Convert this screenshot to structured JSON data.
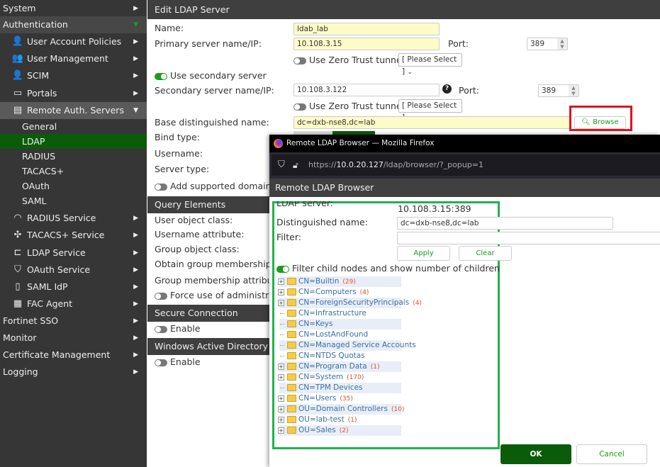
{
  "sidebar": {
    "items": [
      {
        "label": "System",
        "arrow": "▶"
      },
      {
        "label": "Authentication",
        "arrow": "▼"
      },
      {
        "label": "User Account Policies",
        "icon": "user-gear-icon"
      },
      {
        "label": "User Management",
        "icon": "users-icon"
      },
      {
        "label": "SCIM",
        "icon": "user-sync-icon"
      },
      {
        "label": "Portals",
        "icon": "portal-icon"
      },
      {
        "label": "Remote Auth. Servers",
        "icon": "server-cloud-icon"
      },
      {
        "label": "General"
      },
      {
        "label": "LDAP"
      },
      {
        "label": "RADIUS"
      },
      {
        "label": "TACACS+"
      },
      {
        "label": "OAuth"
      },
      {
        "label": "SAML"
      },
      {
        "label": "RADIUS Service",
        "icon": "wifi-icon"
      },
      {
        "label": "TACACS+ Service",
        "icon": "network-icon"
      },
      {
        "label": "LDAP Service",
        "icon": "tree-icon"
      },
      {
        "label": "OAuth Service",
        "icon": "shield-icon"
      },
      {
        "label": "SAML IdP",
        "icon": "document-icon"
      },
      {
        "label": "FAC Agent",
        "icon": "agent-icon"
      },
      {
        "label": "Fortinet SSO"
      },
      {
        "label": "Monitor"
      },
      {
        "label": "Certificate Management"
      },
      {
        "label": "Logging"
      }
    ],
    "active": "LDAP",
    "accent": "#0a5c0a"
  },
  "form": {
    "title": "Edit LDAP Server",
    "name_label": "Name:",
    "name_value": "ldab_lab",
    "primary_label": "Primary server name/IP:",
    "primary_value": "10.108.3.15",
    "port_label": "Port:",
    "port_value": "389",
    "zt_label": "Use Zero Trust tunnel",
    "zt_select": "[ Please Select ]",
    "secondary_toggle": "Use secondary server",
    "secondary_label": "Secondary server name/IP:",
    "secondary_value": "10.108.3.122",
    "port2_label": "Port:",
    "port2_value": "389",
    "zt2_label": "Use Zero Trust tunnel",
    "zt2_select": "[ Please Select ]",
    "base_dn_label": "Base distinguished name:",
    "base_dn_value": "dc=dxb-nse8,dc=lab",
    "browse": "Browse",
    "bind_label": "Bind type:",
    "username_label": "Username:",
    "server_type_label": "Server type:",
    "add_domain_label": "Add supported domain na",
    "query_title": "Query Elements",
    "user_obj": "User object class:",
    "username_attr": "Username attribute:",
    "group_obj": "Group object class:",
    "obtain_group": "Obtain group memberships fr",
    "group_member_attr": "Group membership attribute:",
    "force_admin": "Force use of administrator",
    "secure_title": "Secure Connection",
    "secure_enable": "Enable",
    "wad_title": "Windows Active Directory Do",
    "wad_enable": "Enable"
  },
  "popup": {
    "window_title": "Remote LDAP Browser — Mozilla Firefox",
    "url_prefix": "https://",
    "url_host": "10.0.20.127",
    "url_path": "/ldap/browser/?_popup=1",
    "header": "Remote LDAP Browser",
    "server_label": "LDAP server:",
    "server_value": "10.108.3.15:389",
    "dn_label": "Distinguished name:",
    "dn_value": "dc=dxb-nse8,dc=lab",
    "filter_label": "Filter:",
    "filter_value": "",
    "apply": "Apply",
    "clear": "Clear",
    "filter_toggle": "Filter child nodes and show number of children",
    "tree": [
      {
        "name": "CN=Builtin",
        "count": "(29)",
        "expandable": true
      },
      {
        "name": "CN=Computers",
        "count": "(4)",
        "expandable": true
      },
      {
        "name": "CN=ForeignSecurityPrincipals",
        "count": "(4)",
        "expandable": true
      },
      {
        "name": "CN=Infrastructure",
        "count": "",
        "expandable": false
      },
      {
        "name": "CN=Keys",
        "count": "",
        "expandable": false
      },
      {
        "name": "CN=LostAndFound",
        "count": "",
        "expandable": false
      },
      {
        "name": "CN=Managed Service Accounts",
        "count": "",
        "expandable": false
      },
      {
        "name": "CN=NTDS Quotas",
        "count": "",
        "expandable": false
      },
      {
        "name": "CN=Program Data",
        "count": "(1)",
        "expandable": true
      },
      {
        "name": "CN=System",
        "count": "(170)",
        "expandable": true
      },
      {
        "name": "CN=TPM Devices",
        "count": "",
        "expandable": false
      },
      {
        "name": "CN=Users",
        "count": "(35)",
        "expandable": true
      },
      {
        "name": "OU=Domain Controllers",
        "count": "(10)",
        "expandable": true
      },
      {
        "name": "OU=lab-test",
        "count": "(1)",
        "expandable": true
      },
      {
        "name": "OU=Sales",
        "count": "(2)",
        "expandable": true
      }
    ],
    "ok": "OK",
    "cancel": "Cancel"
  },
  "colors": {
    "highlight_red": "#e0141e",
    "highlight_green": "#22b14c"
  }
}
